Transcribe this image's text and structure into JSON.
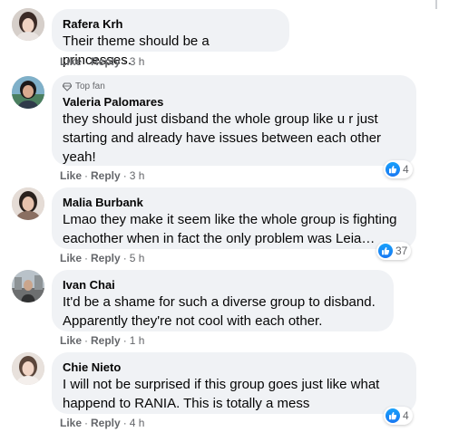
{
  "colors": {
    "bubble": "#f0f2f5",
    "meta_text": "#65676b",
    "like_blue": "#1877f2"
  },
  "comments": [
    {
      "author": "Rafera Krh",
      "badge": "",
      "text": "Their theme should be a princesses.",
      "like_label": "Like",
      "reply_label": "Reply",
      "time": "3 h",
      "reaction_count": ""
    },
    {
      "author": "Valeria Palomares",
      "badge": "Top fan",
      "badge_icon": "diamond-icon",
      "text": "they should just disband the whole group like u r just starting and already have issues between each other yeah!",
      "like_label": "Like",
      "reply_label": "Reply",
      "time": "3 h",
      "reaction_count": "4"
    },
    {
      "author": "Malia Burbank",
      "badge": "",
      "text": "Lmao they make it seem like the whole group is fighting eachother when in fact the only problem was Leia…",
      "like_label": "Like",
      "reply_label": "Reply",
      "time": "5 h",
      "reaction_count": "37"
    },
    {
      "author": "Ivan Chai",
      "badge": "",
      "text": "It'd be a shame for such a diverse group to disband. Apparently they're not cool with each other.",
      "like_label": "Like",
      "reply_label": "Reply",
      "time": "1 h",
      "reaction_count": ""
    },
    {
      "author": "Chie Nieto",
      "badge": "",
      "text": "I will not be surprised if this group goes just like what happend to RANIA. This is totally a mess",
      "like_label": "Like",
      "reply_label": "Reply",
      "time": "4 h",
      "reaction_count": "4"
    }
  ]
}
